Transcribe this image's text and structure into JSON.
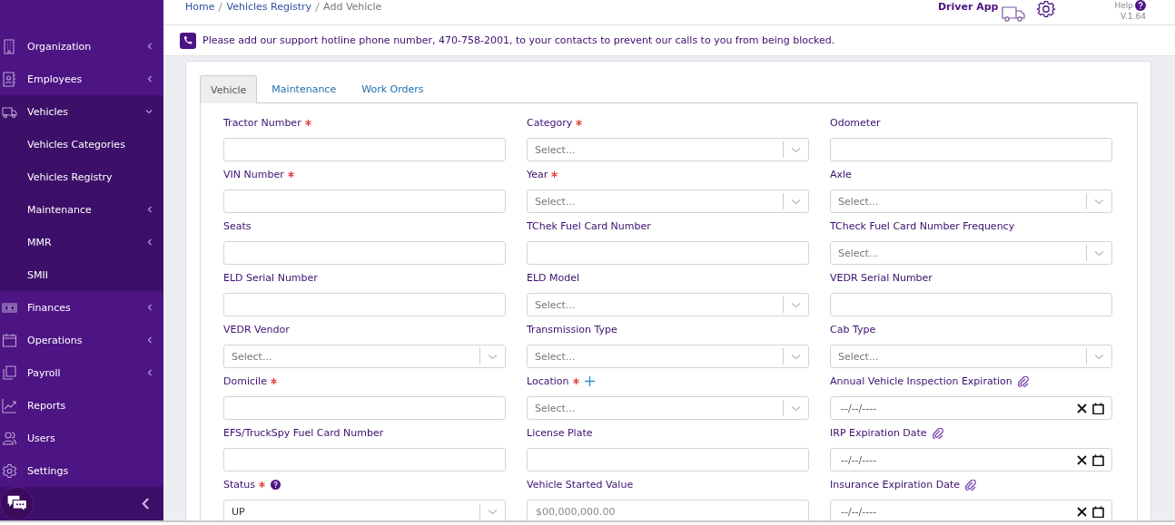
{
  "sidebar": {
    "items": [
      {
        "label": "Organization",
        "submenu": true,
        "expanded": false
      },
      {
        "label": "Employees",
        "submenu": true,
        "expanded": false
      },
      {
        "label": "Vehicles",
        "submenu": true,
        "expanded": true,
        "children": [
          {
            "label": "Vehicles Categories",
            "submenu": false
          },
          {
            "label": "Vehicles Registry",
            "submenu": false
          },
          {
            "label": "Maintenance",
            "submenu": true,
            "expanded": false
          },
          {
            "label": "MMR",
            "submenu": true,
            "expanded": false
          },
          {
            "label": "SMII",
            "submenu": false
          }
        ]
      },
      {
        "label": "Finances",
        "submenu": true,
        "expanded": false
      },
      {
        "label": "Operations",
        "submenu": true,
        "expanded": false
      },
      {
        "label": "Payroll",
        "submenu": true,
        "expanded": false
      },
      {
        "label": "Reports",
        "submenu": false
      },
      {
        "label": "Users",
        "submenu": false
      },
      {
        "label": "Settings",
        "submenu": false
      }
    ]
  },
  "breadcrumb": [
    {
      "label": "Home",
      "link": true
    },
    {
      "label": "Vehicles Registry",
      "link": true
    },
    {
      "label": "Add Vehicle",
      "link": false
    }
  ],
  "header": {
    "driver_app": "Driver App",
    "help": "Help",
    "version": "V.1.64"
  },
  "notice": "Please add our support hotline phone number, 470-758-2001, to your contacts to prevent our calls to you from being blocked.",
  "tabs": [
    {
      "label": "Vehicle",
      "selected": true
    },
    {
      "label": "Maintenance",
      "selected": false
    },
    {
      "label": "Work Orders",
      "selected": false
    }
  ],
  "fields": [
    {
      "label": "Tractor Number",
      "required": true,
      "kind": "text"
    },
    {
      "label": "Category",
      "required": true,
      "kind": "select",
      "placeholder": "Select..."
    },
    {
      "label": "Odometer",
      "required": false,
      "kind": "text"
    },
    {
      "label": "VIN Number",
      "required": true,
      "kind": "text"
    },
    {
      "label": "Year",
      "required": true,
      "kind": "select",
      "placeholder": "Select..."
    },
    {
      "label": "Axle",
      "required": false,
      "kind": "select",
      "placeholder": "Select..."
    },
    {
      "label": "Seats",
      "required": false,
      "kind": "text"
    },
    {
      "label": "TChek Fuel Card Number",
      "required": false,
      "kind": "text"
    },
    {
      "label": "TCheck Fuel Card Number Frequency",
      "required": false,
      "kind": "select",
      "placeholder": "Select..."
    },
    {
      "label": "ELD Serial Number",
      "required": false,
      "kind": "text"
    },
    {
      "label": "ELD Model",
      "required": false,
      "kind": "select",
      "placeholder": "Select..."
    },
    {
      "label": "VEDR Serial Number",
      "required": false,
      "kind": "text"
    },
    {
      "label": "VEDR Vendor",
      "required": false,
      "kind": "select",
      "placeholder": "Select..."
    },
    {
      "label": "Transmission Type",
      "required": false,
      "kind": "select",
      "placeholder": "Select..."
    },
    {
      "label": "Cab Type",
      "required": false,
      "kind": "select",
      "placeholder": "Select..."
    },
    {
      "label": "Domicile",
      "required": true,
      "kind": "text"
    },
    {
      "label": "Location",
      "required": true,
      "kind": "select",
      "placeholder": "Select...",
      "add_button": true
    },
    {
      "label": "Annual Vehicle Inspection Expiration",
      "required": false,
      "kind": "date",
      "placeholder": "--/--/----",
      "attachment": true
    },
    {
      "label": "EFS/TruckSpy Fuel Card Number",
      "required": false,
      "kind": "text"
    },
    {
      "label": "License Plate",
      "required": false,
      "kind": "text"
    },
    {
      "label": "IRP Expiration Date",
      "required": false,
      "kind": "date",
      "placeholder": "--/--/----",
      "attachment": true
    },
    {
      "label": "Status",
      "required": true,
      "kind": "select",
      "value": "UP",
      "help_tip": true
    },
    {
      "label": "Vehicle Started Value",
      "required": false,
      "kind": "text",
      "placeholder": "$00,000,000.00"
    },
    {
      "label": "Insurance Expiration Date",
      "required": false,
      "kind": "date",
      "placeholder": "--/--/----",
      "attachment": true
    }
  ]
}
